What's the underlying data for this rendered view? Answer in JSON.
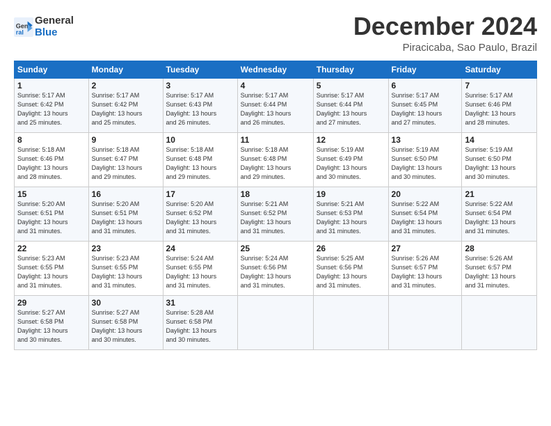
{
  "logo": {
    "line1": "General",
    "line2": "Blue"
  },
  "title": "December 2024",
  "location": "Piracicaba, Sao Paulo, Brazil",
  "days_of_week": [
    "Sunday",
    "Monday",
    "Tuesday",
    "Wednesday",
    "Thursday",
    "Friday",
    "Saturday"
  ],
  "weeks": [
    [
      {
        "day": "1",
        "info": "Sunrise: 5:17 AM\nSunset: 6:42 PM\nDaylight: 13 hours\nand 25 minutes."
      },
      {
        "day": "2",
        "info": "Sunrise: 5:17 AM\nSunset: 6:42 PM\nDaylight: 13 hours\nand 25 minutes."
      },
      {
        "day": "3",
        "info": "Sunrise: 5:17 AM\nSunset: 6:43 PM\nDaylight: 13 hours\nand 26 minutes."
      },
      {
        "day": "4",
        "info": "Sunrise: 5:17 AM\nSunset: 6:44 PM\nDaylight: 13 hours\nand 26 minutes."
      },
      {
        "day": "5",
        "info": "Sunrise: 5:17 AM\nSunset: 6:44 PM\nDaylight: 13 hours\nand 27 minutes."
      },
      {
        "day": "6",
        "info": "Sunrise: 5:17 AM\nSunset: 6:45 PM\nDaylight: 13 hours\nand 27 minutes."
      },
      {
        "day": "7",
        "info": "Sunrise: 5:17 AM\nSunset: 6:46 PM\nDaylight: 13 hours\nand 28 minutes."
      }
    ],
    [
      {
        "day": "8",
        "info": "Sunrise: 5:18 AM\nSunset: 6:46 PM\nDaylight: 13 hours\nand 28 minutes."
      },
      {
        "day": "9",
        "info": "Sunrise: 5:18 AM\nSunset: 6:47 PM\nDaylight: 13 hours\nand 29 minutes."
      },
      {
        "day": "10",
        "info": "Sunrise: 5:18 AM\nSunset: 6:48 PM\nDaylight: 13 hours\nand 29 minutes."
      },
      {
        "day": "11",
        "info": "Sunrise: 5:18 AM\nSunset: 6:48 PM\nDaylight: 13 hours\nand 29 minutes."
      },
      {
        "day": "12",
        "info": "Sunrise: 5:19 AM\nSunset: 6:49 PM\nDaylight: 13 hours\nand 30 minutes."
      },
      {
        "day": "13",
        "info": "Sunrise: 5:19 AM\nSunset: 6:50 PM\nDaylight: 13 hours\nand 30 minutes."
      },
      {
        "day": "14",
        "info": "Sunrise: 5:19 AM\nSunset: 6:50 PM\nDaylight: 13 hours\nand 30 minutes."
      }
    ],
    [
      {
        "day": "15",
        "info": "Sunrise: 5:20 AM\nSunset: 6:51 PM\nDaylight: 13 hours\nand 31 minutes."
      },
      {
        "day": "16",
        "info": "Sunrise: 5:20 AM\nSunset: 6:51 PM\nDaylight: 13 hours\nand 31 minutes."
      },
      {
        "day": "17",
        "info": "Sunrise: 5:20 AM\nSunset: 6:52 PM\nDaylight: 13 hours\nand 31 minutes."
      },
      {
        "day": "18",
        "info": "Sunrise: 5:21 AM\nSunset: 6:52 PM\nDaylight: 13 hours\nand 31 minutes."
      },
      {
        "day": "19",
        "info": "Sunrise: 5:21 AM\nSunset: 6:53 PM\nDaylight: 13 hours\nand 31 minutes."
      },
      {
        "day": "20",
        "info": "Sunrise: 5:22 AM\nSunset: 6:54 PM\nDaylight: 13 hours\nand 31 minutes."
      },
      {
        "day": "21",
        "info": "Sunrise: 5:22 AM\nSunset: 6:54 PM\nDaylight: 13 hours\nand 31 minutes."
      }
    ],
    [
      {
        "day": "22",
        "info": "Sunrise: 5:23 AM\nSunset: 6:55 PM\nDaylight: 13 hours\nand 31 minutes."
      },
      {
        "day": "23",
        "info": "Sunrise: 5:23 AM\nSunset: 6:55 PM\nDaylight: 13 hours\nand 31 minutes."
      },
      {
        "day": "24",
        "info": "Sunrise: 5:24 AM\nSunset: 6:55 PM\nDaylight: 13 hours\nand 31 minutes."
      },
      {
        "day": "25",
        "info": "Sunrise: 5:24 AM\nSunset: 6:56 PM\nDaylight: 13 hours\nand 31 minutes."
      },
      {
        "day": "26",
        "info": "Sunrise: 5:25 AM\nSunset: 6:56 PM\nDaylight: 13 hours\nand 31 minutes."
      },
      {
        "day": "27",
        "info": "Sunrise: 5:26 AM\nSunset: 6:57 PM\nDaylight: 13 hours\nand 31 minutes."
      },
      {
        "day": "28",
        "info": "Sunrise: 5:26 AM\nSunset: 6:57 PM\nDaylight: 13 hours\nand 31 minutes."
      }
    ],
    [
      {
        "day": "29",
        "info": "Sunrise: 5:27 AM\nSunset: 6:58 PM\nDaylight: 13 hours\nand 30 minutes."
      },
      {
        "day": "30",
        "info": "Sunrise: 5:27 AM\nSunset: 6:58 PM\nDaylight: 13 hours\nand 30 minutes."
      },
      {
        "day": "31",
        "info": "Sunrise: 5:28 AM\nSunset: 6:58 PM\nDaylight: 13 hours\nand 30 minutes."
      },
      {
        "day": "",
        "info": ""
      },
      {
        "day": "",
        "info": ""
      },
      {
        "day": "",
        "info": ""
      },
      {
        "day": "",
        "info": ""
      }
    ]
  ]
}
